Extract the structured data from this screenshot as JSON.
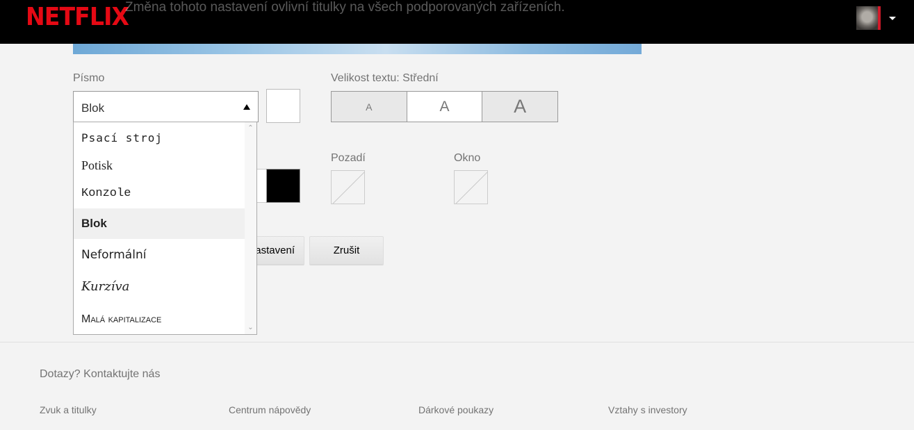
{
  "header": {
    "logo": "NETFLIX",
    "preview_text": "Změna tohoto nastavení ovlivní titulky na všech podporovaných zařízeních.",
    "avatar": "profile-avatar",
    "menu_caret": "caret-down-icon"
  },
  "font": {
    "label": "Písmo",
    "selected_value": "Blok",
    "options": [
      "Psací stroj",
      "Potisk",
      "Konzole",
      "Blok",
      "Neformální",
      "Kurzíva",
      "Malá kapitalizace"
    ],
    "selected_index": 3,
    "swatch_color": "#ffffff"
  },
  "size": {
    "label": "Velikost textu: Střední",
    "options": [
      "A",
      "A",
      "A"
    ],
    "selected_index": 1
  },
  "shadow": {
    "swatch_color": "#000000"
  },
  "background": {
    "label": "Pozadí"
  },
  "window": {
    "label": "Okno"
  },
  "actions": {
    "reset_label": "astavení",
    "cancel_label": "Zrušit"
  },
  "footer": {
    "contact": "Dotazy? Kontaktujte nás",
    "links": [
      "Zvuk a titulky",
      "Centrum nápovědy",
      "Dárkové poukazy",
      "Vztahy s investory"
    ]
  },
  "colors": {
    "brand": "#e50914",
    "header_bg": "#000000",
    "page_bg": "#f3f3f3"
  }
}
